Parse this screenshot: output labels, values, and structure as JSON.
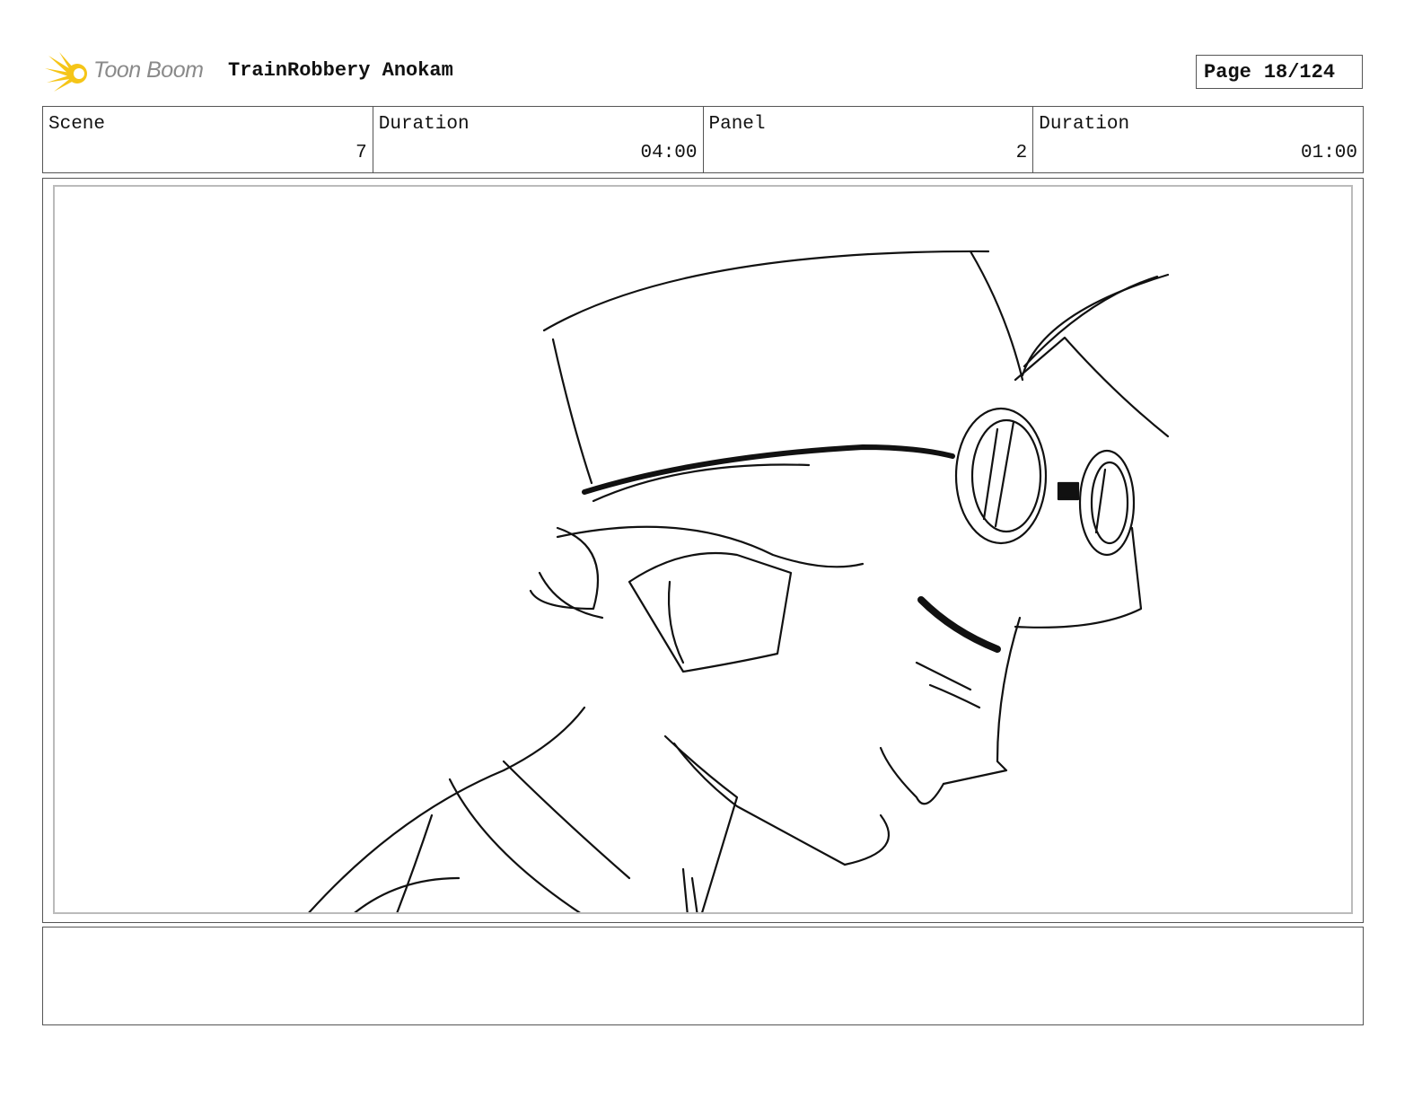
{
  "header": {
    "logo_text": "Toon Boom",
    "logo_icon": "starburst-logo-icon",
    "project_title": "TrainRobbery Anokam",
    "page_label": "Page",
    "page_number": "18/124"
  },
  "info": {
    "scene_label": "Scene",
    "scene_value": "7",
    "scene_duration_label": "Duration",
    "scene_duration_value": "04:00",
    "panel_label": "Panel",
    "panel_value": "2",
    "panel_duration_label": "Duration",
    "panel_duration_value": "01:00"
  },
  "panel": {
    "drawing": "sketch of a character in profile wearing a cap and goggles"
  },
  "notes": {
    "text": ""
  },
  "colors": {
    "logo_yellow": "#f5c518",
    "border": "#555555",
    "inner_border": "#bbbbbb"
  }
}
